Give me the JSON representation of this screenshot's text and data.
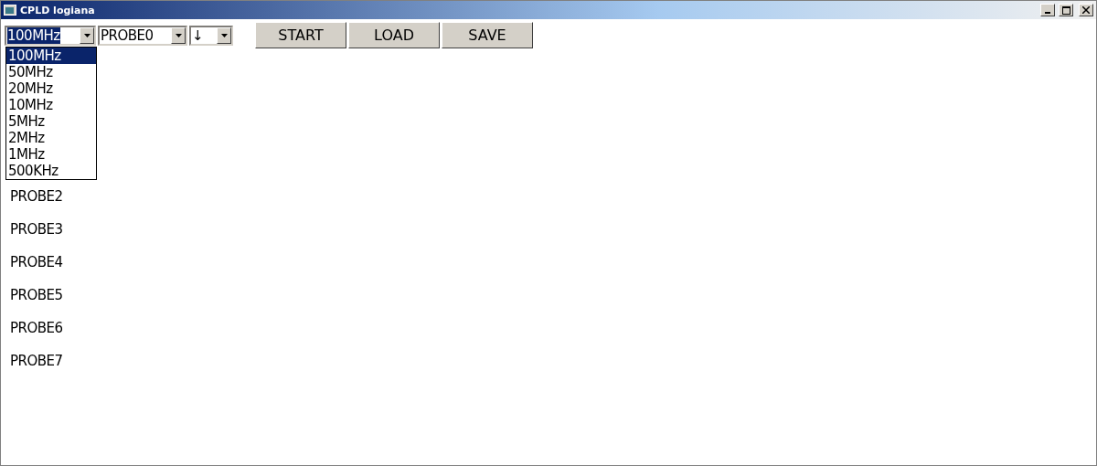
{
  "window": {
    "title": "CPLD logiana"
  },
  "toolbar": {
    "combos": [
      {
        "value": "100MHz",
        "expanded": true
      },
      {
        "value": "PROBE0",
        "expanded": false
      },
      {
        "value": "↓",
        "expanded": false
      }
    ],
    "buttons": [
      "START",
      "LOAD",
      "SAVE"
    ]
  },
  "dropdown": {
    "options": [
      {
        "label": "100MHz",
        "selected": true
      },
      {
        "label": "50MHz",
        "selected": false
      },
      {
        "label": "20MHz",
        "selected": false
      },
      {
        "label": "10MHz",
        "selected": false
      },
      {
        "label": "5MHz",
        "selected": false
      },
      {
        "label": "2MHz",
        "selected": false
      },
      {
        "label": "1MHz",
        "selected": false
      },
      {
        "label": "500KHz",
        "selected": false
      }
    ]
  },
  "probes": [
    "PROBE2",
    "PROBE3",
    "PROBE4",
    "PROBE5",
    "PROBE6",
    "PROBE7"
  ]
}
